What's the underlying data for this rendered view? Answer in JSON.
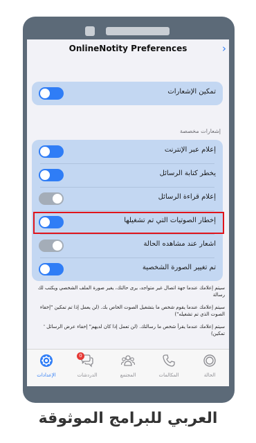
{
  "header": {
    "title": "OnlineNotity Preferences"
  },
  "main_toggle": {
    "label": "تمكين الإشعارات",
    "on": true
  },
  "section_header": "إشعارات مخصصة",
  "settings": [
    {
      "label": "إعلام عبر الإنترنت",
      "on": true
    },
    {
      "label": "يخطر كتابة الرسائل",
      "on": true
    },
    {
      "label": "إعلام قراءة الرسائل",
      "on": false
    },
    {
      "label": "إخطار الصوتيات التي تم تشغيلها",
      "on": true
    },
    {
      "label": "اشعار عند مشاهده الحالة",
      "on": false
    },
    {
      "label": "تم تغيير الصورة الشخصية",
      "on": true
    }
  ],
  "notes": [
    "سيتم إعلامك عندما جهة اتصال غير متواجد، يرى حالتك، يغير صورة الملف الشخصي ويكتب لك رسالة",
    "سيتم إعلامك عندما يقوم شخص ما بتشغيل الصوت الخاص بك. (لن يعمل إذا تم تمكين \"إخفاء الصوت الذي تم تشغيله\")",
    "سيتم إعلامك عندما يقرأ شخص ما رسالتك. (لن تعمل إذا كان لديهم\" إخفاء عرض الرسائل ' تمكين)"
  ],
  "tabs": [
    {
      "label": "الحالة",
      "icon": "status-ring-icon",
      "active": false
    },
    {
      "label": "المكالمات",
      "icon": "phone-icon",
      "active": false
    },
    {
      "label": "المجتمع",
      "icon": "community-icon",
      "active": false
    },
    {
      "label": "الدردشات",
      "icon": "chat-bubbles-icon",
      "active": false,
      "badge": "0"
    },
    {
      "label": "الإعدادات",
      "icon": "settings-gear-icon",
      "active": true
    }
  ],
  "caption": "العربي للبرامج الموثوقة",
  "colors": {
    "accent": "#2f7df6",
    "card": "#c3d7f2",
    "highlight": "#e0141b",
    "frame": "#5c6a78"
  }
}
